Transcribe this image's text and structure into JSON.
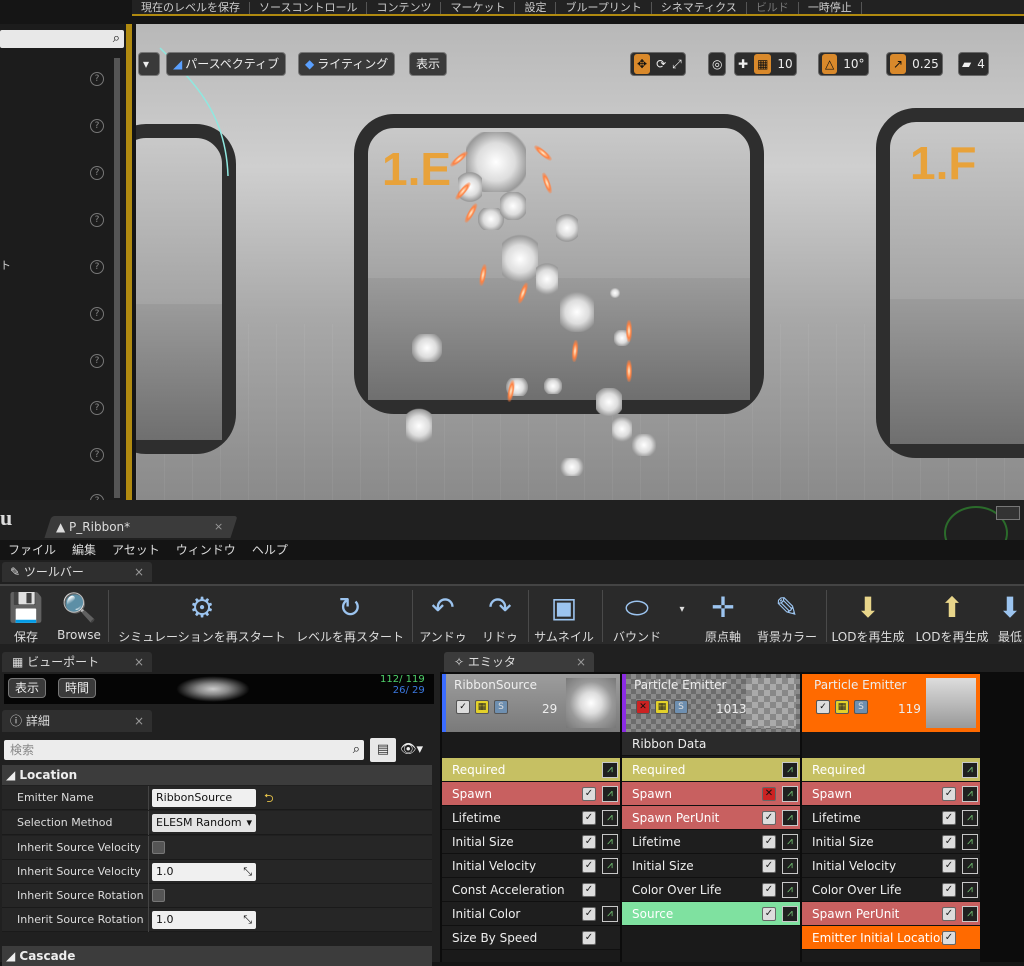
{
  "main_menu": {
    "items": [
      "現在のレベルを保存",
      "ソースコントロール",
      "コンテンツ",
      "マーケット",
      "設定",
      "ブループリント",
      "シネマティクス",
      "ビルド",
      "一時停止"
    ]
  },
  "left_panel": {
    "fragments": [
      "ト"
    ]
  },
  "viewport": {
    "perspective_label": "パースペクティブ",
    "lighting_label": "ライティング",
    "show_label": "表示",
    "grid_snap": "10",
    "rotation_snap": "10°",
    "scale_snap": "0.25",
    "camera_speed": "4",
    "door_labels": [
      "1.E",
      "1.F"
    ]
  },
  "editor": {
    "tab_title": "P_Ribbon*",
    "menu": [
      "ファイル",
      "編集",
      "アセット",
      "ウィンドウ",
      "ヘルプ"
    ],
    "toolbar_tab": "ツールバー",
    "toolbar": [
      {
        "label": "保存",
        "icon": "save-icon"
      },
      {
        "label": "Browse",
        "icon": "browse-icon"
      },
      {
        "label": "シミュレーションを再スタート",
        "icon": "restart-sim-icon"
      },
      {
        "label": "レベルを再スタート",
        "icon": "restart-level-icon"
      },
      {
        "label": "アンドゥ",
        "icon": "undo-icon"
      },
      {
        "label": "リドゥ",
        "icon": "redo-icon"
      },
      {
        "label": "サムネイル",
        "icon": "thumbnail-icon"
      },
      {
        "label": "バウンド",
        "icon": "bounds-icon"
      },
      {
        "label": "原点軸",
        "icon": "origin-axis-icon"
      },
      {
        "label": "背景カラー",
        "icon": "background-color-icon"
      },
      {
        "label": "LODを再生成",
        "icon": "regen-lod-icon"
      },
      {
        "label": "LODを再生成",
        "icon": "regen-lod-icon"
      },
      {
        "label": "最低",
        "icon": "lowest-lod-icon"
      }
    ],
    "viewport_tab": "ビューポート",
    "viewport_show": "表示",
    "viewport_time": "時間",
    "viewport_stats": [
      "112/ 119",
      "26/ 29"
    ],
    "details_tab": "詳細",
    "details_search_placeholder": "検索",
    "location_title": "Location",
    "cascade_title": "Cascade",
    "props": [
      {
        "label": "Emitter Name",
        "value": "RibbonSource"
      },
      {
        "label": "Selection Method",
        "value": "ELESM Random"
      },
      {
        "label": "Inherit Source Velocity",
        "value": ""
      },
      {
        "label": "Inherit Source Velocity Sc",
        "value": "1.0"
      },
      {
        "label": "Inherit Source Rotation",
        "value": ""
      },
      {
        "label": "Inherit Source Rotation Sc",
        "value": "1.0"
      }
    ],
    "emitters_tab": "エミッタ"
  },
  "emitters": [
    {
      "name": "RibbonSource",
      "count": "29",
      "accent": "#3b6cff",
      "typedata": "",
      "modules": [
        {
          "name": "Required",
          "color": "#c6c063",
          "check": false,
          "graph": true
        },
        {
          "name": "Spawn",
          "color": "#c86060",
          "check": true,
          "graph": true
        },
        {
          "name": "Lifetime",
          "color": "#1e1e1e",
          "check": true,
          "graph": true
        },
        {
          "name": "Initial Size",
          "color": "#1e1e1e",
          "check": true,
          "graph": true
        },
        {
          "name": "Initial Velocity",
          "color": "#1e1e1e",
          "check": true,
          "graph": true
        },
        {
          "name": "Const Acceleration",
          "color": "#1e1e1e",
          "check": true,
          "graph": false
        },
        {
          "name": "Initial Color",
          "color": "#1e1e1e",
          "check": true,
          "graph": true
        },
        {
          "name": "Size By Speed",
          "color": "#1e1e1e",
          "check": true,
          "graph": false
        }
      ]
    },
    {
      "name": "Particle Emitter",
      "count": "1013",
      "accent": "#8a2be2",
      "typedata": "Ribbon Data",
      "modules": [
        {
          "name": "Required",
          "color": "#c6c063",
          "check": false,
          "graph": true
        },
        {
          "name": "Spawn",
          "color": "#c86060",
          "check": true,
          "graph": true,
          "disabled": true
        },
        {
          "name": "Spawn PerUnit",
          "color": "#c86060",
          "check": true,
          "graph": true
        },
        {
          "name": "Lifetime",
          "color": "#1e1e1e",
          "check": true,
          "graph": true
        },
        {
          "name": "Initial Size",
          "color": "#1e1e1e",
          "check": true,
          "graph": true
        },
        {
          "name": "Color Over Life",
          "color": "#1e1e1e",
          "check": true,
          "graph": true
        },
        {
          "name": "Source",
          "color": "#7fe1a0",
          "check": true,
          "graph": true
        }
      ]
    },
    {
      "name": "Particle Emitter",
      "count": "119",
      "accent": "#ff6a00",
      "typedata": "",
      "modules": [
        {
          "name": "Required",
          "color": "#c6c063",
          "check": false,
          "graph": true
        },
        {
          "name": "Spawn",
          "color": "#c86060",
          "check": true,
          "graph": true
        },
        {
          "name": "Lifetime",
          "color": "#1e1e1e",
          "check": true,
          "graph": true
        },
        {
          "name": "Initial Size",
          "color": "#1e1e1e",
          "check": true,
          "graph": true
        },
        {
          "name": "Initial Velocity",
          "color": "#1e1e1e",
          "check": true,
          "graph": true
        },
        {
          "name": "Color Over Life",
          "color": "#1e1e1e",
          "check": true,
          "graph": true
        },
        {
          "name": "Spawn PerUnit",
          "color": "#c86060",
          "check": true,
          "graph": true
        },
        {
          "name": "Emitter Initial Location",
          "color": "#ff6a00",
          "check": true,
          "graph": false
        }
      ]
    }
  ]
}
